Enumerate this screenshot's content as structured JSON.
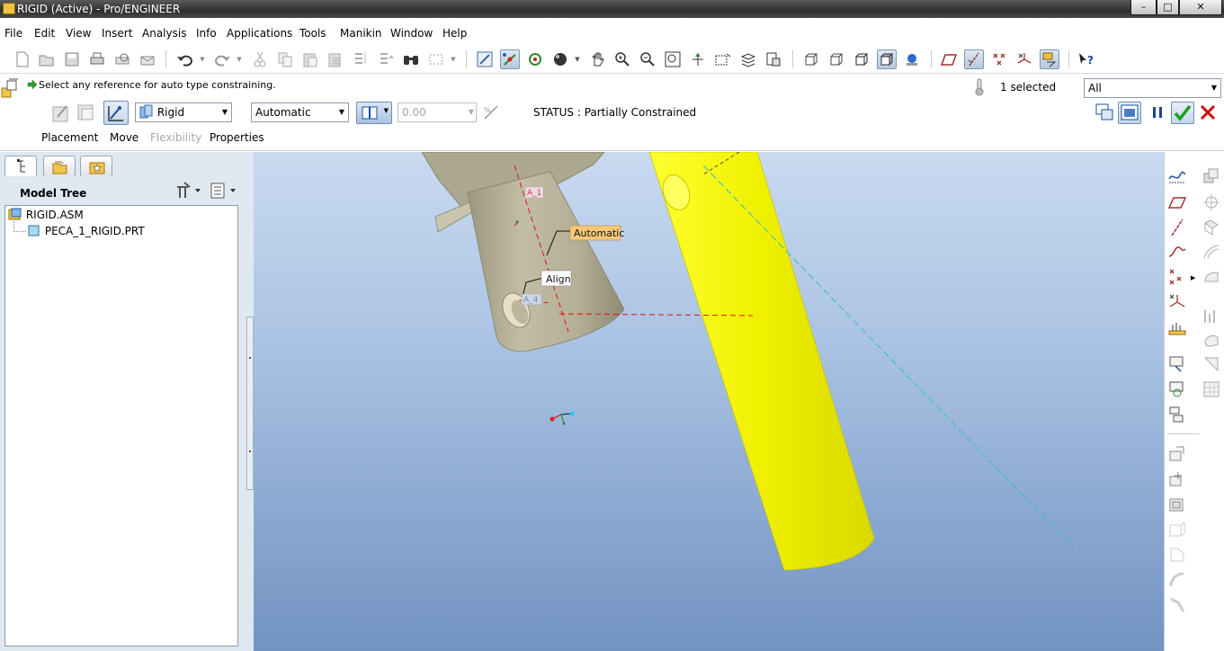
{
  "window": {
    "title": "RIGID (Active) - Pro/ENGINEER",
    "controls": [
      "minimize",
      "maximize",
      "close"
    ]
  },
  "menu": [
    "File",
    "Edit",
    "View",
    "Insert",
    "Analysis",
    "Info",
    "Applications",
    "Tools",
    "Manikin",
    "Window",
    "Help"
  ],
  "toolbar_icons": [
    "new-icon",
    "open-icon",
    "save-icon",
    "print-icon",
    "print-preview-icon",
    "email-icon",
    "undo-icon",
    "undo-dropdown-icon",
    "redo-icon",
    "redo-dropdown-icon",
    "cut-icon",
    "copy-icon",
    "paste-icon",
    "paste-special-icon",
    "regenerate-icon",
    "regenerate-manager-icon",
    "find-icon",
    "select-box-icon",
    "select-dropdown-icon",
    "repaint-icon",
    "spin-center-icon",
    "orient-mode-icon",
    "shading-icon",
    "shading-dropdown-icon",
    "pan-icon",
    "zoom-in-icon",
    "zoom-out-icon",
    "refit-icon",
    "reorient-icon",
    "saved-views-icon",
    "layers-icon",
    "view-manager-icon",
    "wireframe-icon",
    "hidden-line-icon",
    "no-hidden-icon",
    "shaded-icon",
    "enhanced-realism-icon",
    "datum-planes-icon",
    "datum-axes-icon",
    "datum-points-icon",
    "csys-icon",
    "annotations-icon",
    "context-help-icon"
  ],
  "dashboard": {
    "message": "Select any reference for auto type constraining.",
    "selection_count": "1 selected",
    "filter": "All",
    "connection_type": "Rigid",
    "constraint_type": "Automatic",
    "offset_value": "0.00",
    "status": "STATUS : Partially Constrained",
    "tabs": [
      "Placement",
      "Move",
      "Flexibility",
      "Properties"
    ]
  },
  "model_tree": {
    "title": "Model Tree",
    "tabs": [
      "model-tree-tab",
      "folder-browser-tab",
      "favorites-tab"
    ],
    "items": [
      {
        "label": "RIGID.ASM",
        "icon": "assembly-icon"
      },
      {
        "label": "PECA_1_RIGID.PRT",
        "icon": "part-icon"
      }
    ]
  },
  "viewport": {
    "labels": {
      "automatic": "Automatic",
      "align": "Align",
      "axis_a1": "A_1",
      "axis_a4": "A_4"
    },
    "colors": {
      "background_top": "#c9daf0",
      "background_bottom": "#7393c2",
      "part_beige": "#b7b198",
      "part_yellow": "#f5f500",
      "constraint_line": "#e01010",
      "label_highlight": "#f7c878"
    }
  },
  "right_toolbar_icons": [
    "sketch-icon",
    "datum-plane-icon",
    "datum-axis-icon",
    "datum-curve-icon",
    "datum-point-icon",
    "offset-point-icon",
    "csys-tool-icon",
    "analysis-icon",
    "component-place-icon",
    "component-create-icon",
    "component-package-icon",
    "assemble-icon",
    "create-component-icon",
    "repeat-icon",
    "mirror-component-icon",
    "edit-definition-icon",
    "restructure-icon",
    "merge-icon",
    "cut-out-icon",
    "shrinkwrap-icon",
    "skeleton-icon",
    "hole-icon",
    "extrude-icon",
    "revolve-icon",
    "sweep-icon",
    "blend-icon",
    "round-icon",
    "chamfer-icon",
    "draft-icon",
    "pattern-icon"
  ]
}
